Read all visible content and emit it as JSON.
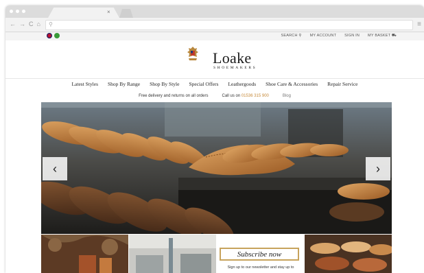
{
  "browser": {
    "tab_close": "×",
    "nav_icons": [
      "←",
      "→",
      "C",
      "⌂"
    ],
    "url_search_glyph": "⚲",
    "menu_glyph": "≡"
  },
  "topbar": {
    "search": "SEARCH",
    "my_account": "MY ACCOUNT",
    "sign_in": "SIGN IN",
    "my_basket": "MY BASKET"
  },
  "brand": {
    "name": "Loake",
    "subtitle": "SHOEMAKERS"
  },
  "nav": {
    "items": [
      "Latest Styles",
      "Shop By Range",
      "Shop By Style",
      "Special Offers",
      "Leathergoods",
      "Shoe Care & Accessories",
      "Repair Service"
    ]
  },
  "info": {
    "delivery": "Free delivery and returns on all orders",
    "call_label": "Call us on",
    "phone": "01536 315 900",
    "blog": "Blog"
  },
  "hero": {
    "prev": "‹",
    "next": "›"
  },
  "subscribe": {
    "title": "Subscribe now",
    "text": "Sign up to our newsletter and stay up to"
  }
}
